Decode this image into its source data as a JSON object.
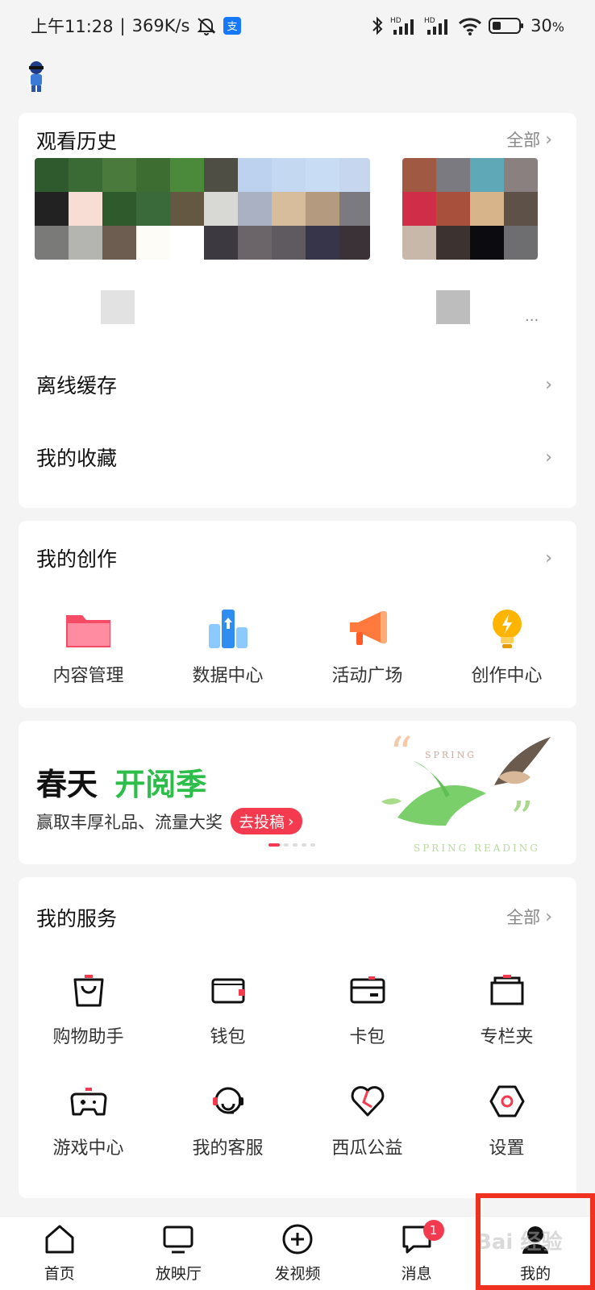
{
  "status_bar": {
    "time": "上午11:28",
    "network_speed": "369K/s",
    "battery": "30",
    "battery_unit": "%"
  },
  "history": {
    "title": "观看历史",
    "all_label": "全部",
    "more_dots": "..."
  },
  "menu": {
    "offline_cache": "离线缓存",
    "favorites": "我的收藏"
  },
  "creation": {
    "title": "我的创作",
    "items": [
      {
        "label": "内容管理",
        "icon": "folder-icon"
      },
      {
        "label": "数据中心",
        "icon": "data-chart-icon"
      },
      {
        "label": "活动广场",
        "icon": "megaphone-icon"
      },
      {
        "label": "创作中心",
        "icon": "lightbulb-icon"
      }
    ]
  },
  "banner": {
    "title_black": "春天",
    "title_green": "开阅季",
    "subtitle": "赢取丰厚礼品、流量大奖",
    "cta": "去投稿",
    "art_text_1": "SPRING",
    "art_text_2": "SPRING  READING"
  },
  "services": {
    "title": "我的服务",
    "all_label": "全部",
    "items": [
      {
        "label": "购物助手",
        "icon": "shopping-bag-icon"
      },
      {
        "label": "钱包",
        "icon": "wallet-icon"
      },
      {
        "label": "卡包",
        "icon": "card-icon"
      },
      {
        "label": "专栏夹",
        "icon": "column-folder-icon"
      },
      {
        "label": "游戏中心",
        "icon": "gamepad-icon"
      },
      {
        "label": "我的客服",
        "icon": "headset-icon"
      },
      {
        "label": "西瓜公益",
        "icon": "heart-icon"
      },
      {
        "label": "设置",
        "icon": "settings-hex-icon"
      }
    ]
  },
  "bottom_nav": {
    "items": [
      {
        "label": "首页",
        "icon": "home-icon"
      },
      {
        "label": "放映厅",
        "icon": "tv-icon"
      },
      {
        "label": "发视频",
        "icon": "plus-circle-icon"
      },
      {
        "label": "消息",
        "icon": "message-icon",
        "badge": "1"
      },
      {
        "label": "我的",
        "icon": "profile-icon"
      }
    ]
  },
  "watermark": "Bai 经验",
  "colors": {
    "accent_red": "#f33a4e",
    "green": "#2dbe4a",
    "highlight": "#f0311f"
  }
}
